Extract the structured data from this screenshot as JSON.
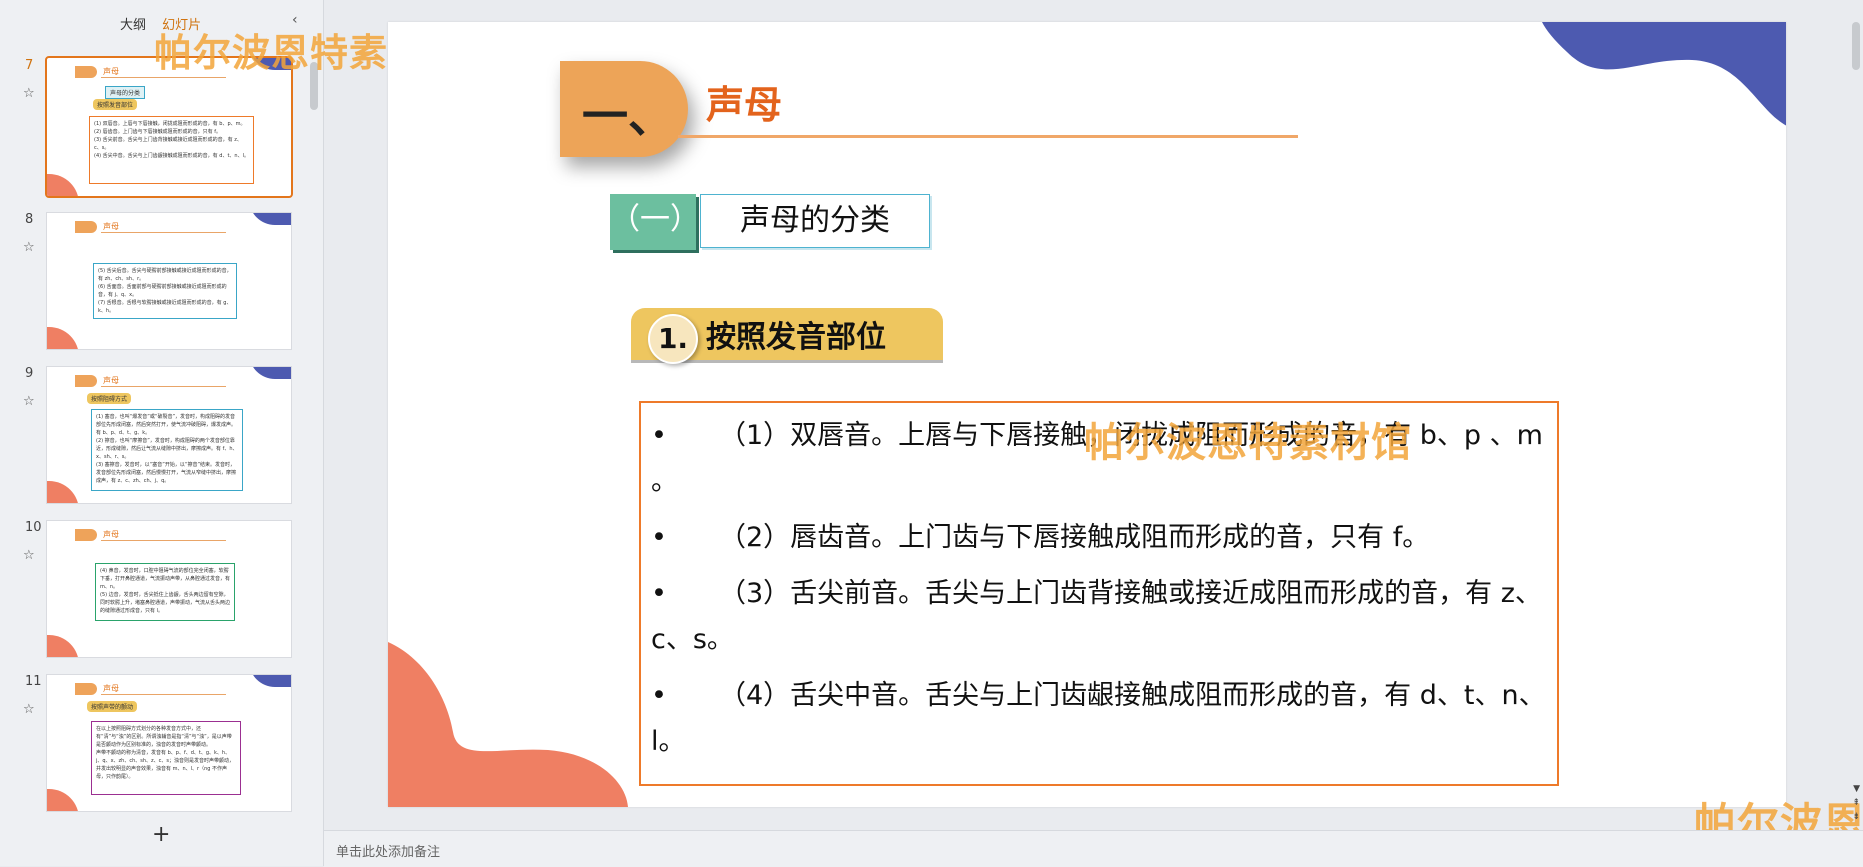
{
  "left_panel": {
    "tabs": [
      "大纲",
      "幻灯片"
    ],
    "collapse_icon": "chevron-left-icon",
    "add_slide_label": "+",
    "thumbnails": [
      {
        "number": "7",
        "selected": true,
        "title": "声母",
        "subheading": "声母的分类",
        "sub_item": "按照发音部位",
        "lines": [
          "(1) 双唇音。上唇与下唇接触，闭拢成阻而形成的音，有 b、p、m。",
          "(2) 唇齿音。上门齿与下唇接触成阻而形成的音，只有 f。",
          "(3) 舌尖前音。舌尖与上门齿背接触或接近成阻而形成的音，有 z、c、s。",
          "(4) 舌尖中音。舌尖与上门齿龈接触成阻而形成的音，有 d、t、n、l。"
        ]
      },
      {
        "number": "8",
        "selected": false,
        "title": "声母",
        "lines": [
          "(5) 舌尖后音。舌尖与硬腭前部接触或接近成阻而形成的音，有 zh、ch、sh、r。",
          "(6) 舌面音。舌面前部与硬腭前部接触或接近成阻而形成的音，有 j、q、x。",
          "(7) 舌根音。舌根与软腭接触或接近成阻而形成的音，有 g、k、h。"
        ]
      },
      {
        "number": "9",
        "selected": false,
        "title": "声母",
        "sub_item": "按照阻碍方式",
        "lines": [
          "(1) 塞音，也叫“爆发音”或“破裂音”，发音时，构成阻碍的发音部位先形成闭塞，然后突然打开，使气流冲破阻碍，爆发成声。有 b、p、d、t、g、k。",
          "(2) 擦音，也叫“摩擦音”，发音时，构成阻碍的两个发音部位靠近，形成缝隙，然后让气流从缝隙中挤出，摩擦成声。有 f、h、x、sh、r、s。",
          "(3) 塞擦音，发音时，以“塞音”开始，以“擦音”结束。发音时，发音部位先形成闭塞，然后慢慢打开，气流从窄缝中挤出，摩擦成声，有 z、c、zh、ch、j、q。"
        ]
      },
      {
        "number": "10",
        "selected": false,
        "title": "声母",
        "lines": [
          "(4) 鼻音，发音时，口腔中阻碍气流的部位完全闭塞，软腭下垂，打开鼻腔通道，气流振动声带，从鼻腔通过发音，有 m、n。",
          "(5) 边音，发音时，舌尖抵住上齿龈，舌头两边留有空隙，同时软腭上升，堵塞鼻腔通道，声带振动，气流从舌头两边的缝隙通过形成音，只有 l。"
        ]
      },
      {
        "number": "11",
        "selected": false,
        "title": "声母",
        "sub_item": "按照声带的颤动",
        "lines": [
          "在以上按照阻碍方式划分的各种发音方式中，还有“清”与“浊”的区别。所谓浊辅音是指“清”与“浊”，是以声带是否颤动作为区别标准的，浊音的发音时声带颤动。",
          "声带不颤动的称为清音，发音有 b、p、f、d、t、g、k、h、j、q、x、zh、ch、sh、z、c、s；浊音则是发音时声带颤动，并发出较明显的声音效果，浊音有 m、n、l、r（ng 不作声母，只作韵尾）。"
        ]
      }
    ]
  },
  "slide": {
    "heading_num": "一、",
    "heading_title": "声母",
    "section_badge": "（一）",
    "section_label": "声母的分类",
    "sub_num": "1.",
    "sub_title": "按照发音部位",
    "bullet_symbol": "•",
    "bullets": [
      "（1）双唇音。上唇与下唇接触，闭拢成阻而形成的音，有 b、p 、m 。",
      "（2）唇齿音。上门齿与下唇接触成阻而形成的音，只有 f。",
      "（3）舌尖前音。舌尖与上门齿背接触或接近成阻而形成的音，有 z、c、s。",
      "（4）舌尖中音。舌尖与上门齿龈接触成阻而形成的音，有 d、t、n、l。"
    ]
  },
  "watermark": "帕尔波恩特素材馆",
  "notes_placeholder": "单击此处添加备注",
  "scroll_buttons": [
    "▼",
    "⇞",
    "⇟"
  ],
  "colors": {
    "accent_orange": "#e3631c",
    "header_shape": "#eda458",
    "section_badge": "#6cbf9f",
    "pill_yellow": "#eec65f",
    "box_border": "#ee7a2a",
    "blob_blue": "#4d5ab0",
    "blob_coral": "#ef7f63"
  }
}
